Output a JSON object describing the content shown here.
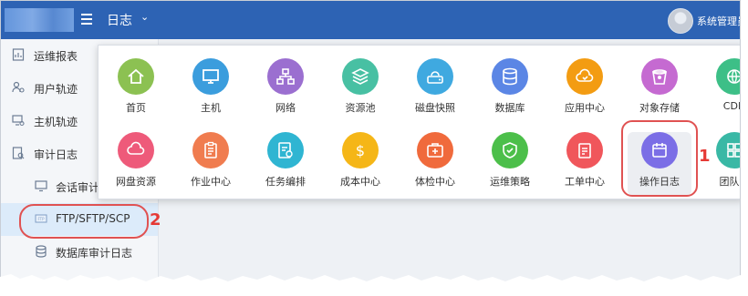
{
  "header": {
    "title": "日志",
    "user": "系统管理员"
  },
  "sidebar": {
    "items": [
      {
        "label": "运维报表",
        "icon": "report-icon"
      },
      {
        "label": "用户轨迹",
        "icon": "user-track-icon"
      },
      {
        "label": "主机轨迹",
        "icon": "host-track-icon"
      },
      {
        "label": "审计日志",
        "icon": "audit-log-icon"
      },
      {
        "label": "会话审计",
        "icon": "monitor-icon"
      },
      {
        "label": "FTP/SFTP/SCP",
        "icon": "ftp-icon"
      },
      {
        "label": "数据库审计日志",
        "icon": "database-icon"
      }
    ]
  },
  "apps": {
    "row1": [
      {
        "label": "首页",
        "color": "#8cc152",
        "icon": "home-icon"
      },
      {
        "label": "主机",
        "color": "#3b9ddd",
        "icon": "host-icon"
      },
      {
        "label": "网络",
        "color": "#9b6fd0",
        "icon": "network-icon"
      },
      {
        "label": "资源池",
        "color": "#48c0a3",
        "icon": "resource-pool-icon"
      },
      {
        "label": "磁盘快照",
        "color": "#3fa9e0",
        "icon": "disk-snapshot-icon"
      },
      {
        "label": "数据库",
        "color": "#5b86e5",
        "icon": "database-icon"
      },
      {
        "label": "应用中心",
        "color": "#f39c12",
        "icon": "app-center-icon"
      },
      {
        "label": "对象存储",
        "color": "#c56ad1",
        "icon": "object-storage-icon"
      },
      {
        "label": "CDN",
        "color": "#3dbf87",
        "icon": "cdn-icon"
      }
    ],
    "row2": [
      {
        "label": "网盘资源",
        "color": "#ee5a7a",
        "icon": "cloud-drive-icon"
      },
      {
        "label": "作业中心",
        "color": "#f07c4f",
        "icon": "job-center-icon"
      },
      {
        "label": "任务编排",
        "color": "#2fb5d2",
        "icon": "task-orchestration-icon"
      },
      {
        "label": "成本中心",
        "color": "#f5b617",
        "icon": "cost-center-icon"
      },
      {
        "label": "体检中心",
        "color": "#f06a3c",
        "icon": "health-check-icon"
      },
      {
        "label": "运维策略",
        "color": "#4cbf4a",
        "icon": "ops-policy-icon"
      },
      {
        "label": "工单中心",
        "color": "#f0565b",
        "icon": "ticket-center-icon"
      },
      {
        "label": "操作日志",
        "color": "#7b6ee6",
        "icon": "operation-log-icon"
      },
      {
        "label": "团队设",
        "color": "#39b8a5",
        "icon": "team-settings-icon"
      }
    ]
  },
  "annotations": {
    "step1": "1",
    "step2": "2"
  }
}
